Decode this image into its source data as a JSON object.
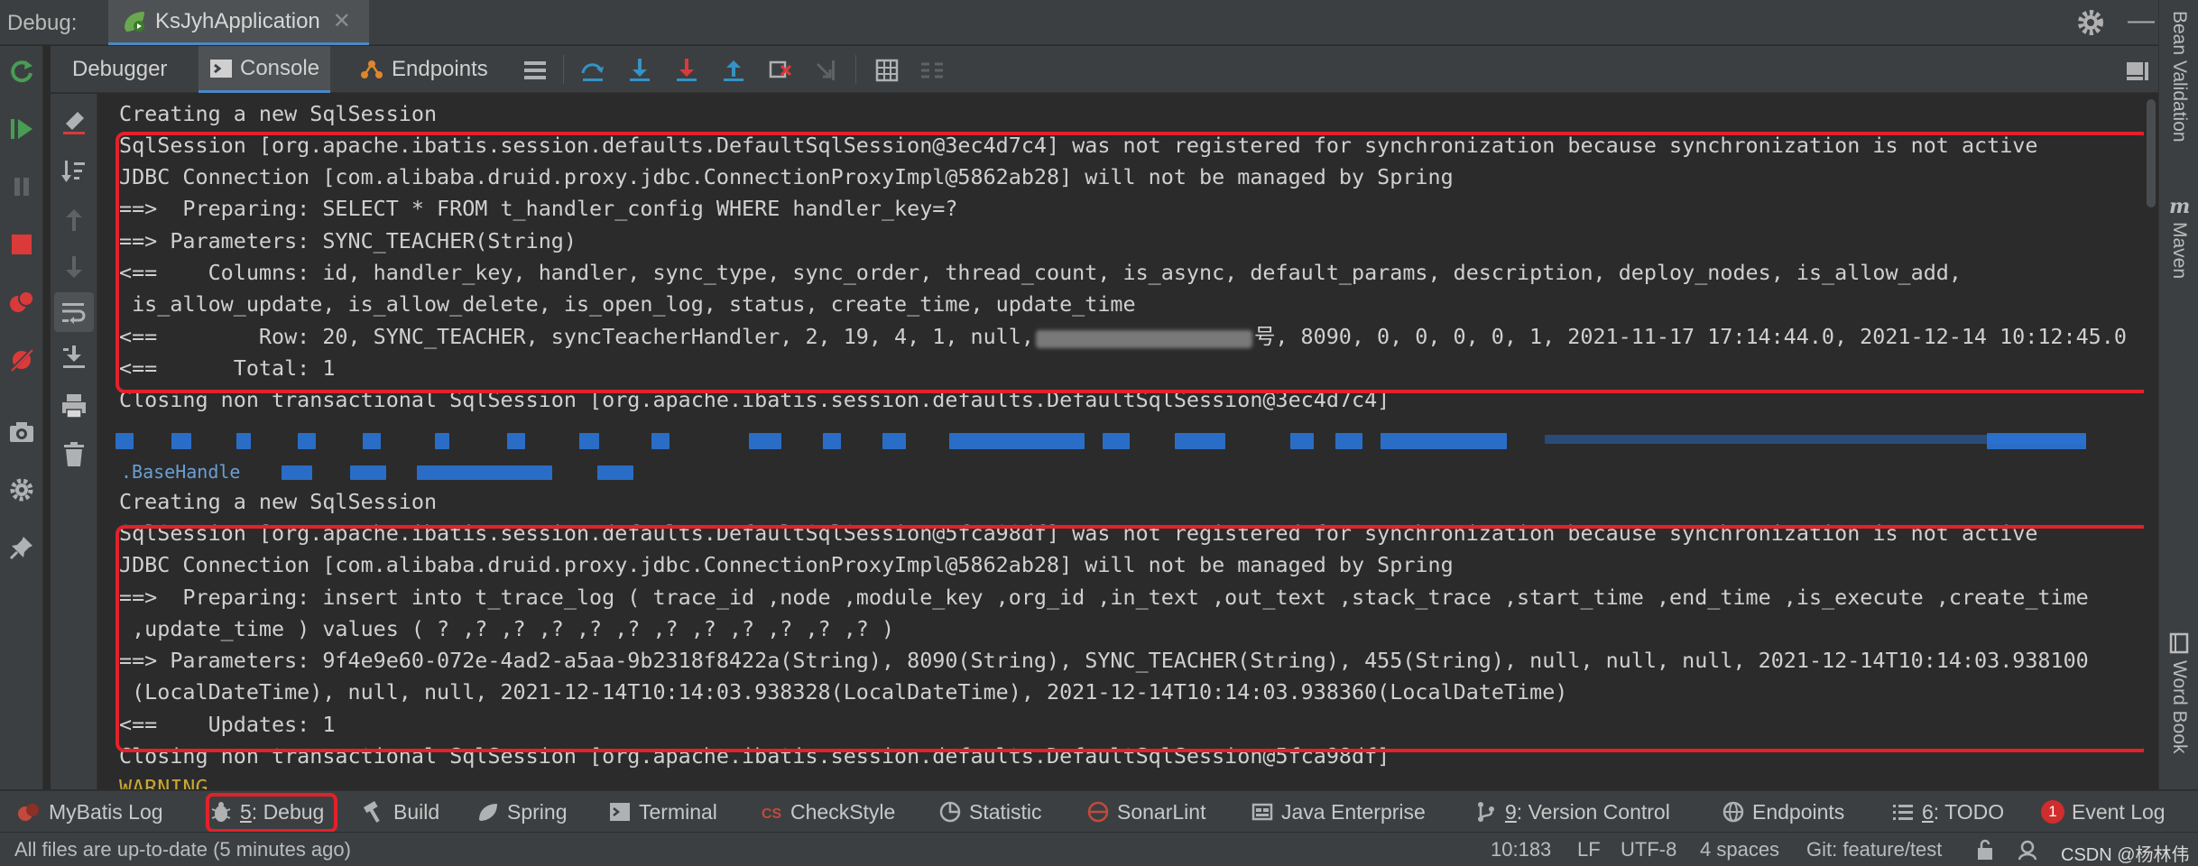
{
  "title_bar": {
    "debug_label": "Debug:",
    "run_config_tab": "KsJyhApplication",
    "close_glyph": "✕"
  },
  "toolbar": {
    "tabs": [
      {
        "label": "Debugger",
        "icon": "none"
      },
      {
        "label": "Console",
        "icon": "console-icon"
      },
      {
        "label": "Endpoints",
        "icon": "endpoints-icon"
      }
    ],
    "active_tab": "Console"
  },
  "right_strip": {
    "bean_validation": "Bean Validation",
    "maven": "Maven",
    "word_book": "Word Book"
  },
  "console": {
    "lines": [
      "Creating a new SqlSession",
      "SqlSession [org.apache.ibatis.session.defaults.DefaultSqlSession@3ec4d7c4] was not registered for synchronization because synchronization is not active",
      "JDBC Connection [com.alibaba.druid.proxy.jdbc.ConnectionProxyImpl@5862ab28] will not be managed by Spring",
      "==>  Preparing: SELECT * FROM t_handler_config WHERE handler_key=?",
      "==> Parameters: SYNC_TEACHER(String)",
      "<==    Columns: id, handler_key, handler, sync_type, sync_order, thread_count, is_async, default_params, description, deploy_nodes, is_allow_add,",
      " is_allow_update, is_allow_delete, is_open_log, status, create_time, update_time",
      "<==        Row: 20, SYNC_TEACHER, syncTeacherHandler, 2, 19, 4, 1, null,",
      "号, 8090, 0, 0, 0, 0, 1, 2021-11-17 17:14:44.0, 2021-12-14 10:12:45.0",
      "<==      Total: 1",
      "Closing non transactional SqlSession [org.apache.ibatis.session.defaults.DefaultSqlSession@3ec4d7c4]",
      "Creating a new SqlSession",
      "SqlSession [org.apache.ibatis.session.defaults.DefaultSqlSession@5fca98df] was not registered for synchronization because synchronization is not active",
      "JDBC Connection [com.alibaba.druid.proxy.jdbc.ConnectionProxyImpl@5862ab28] will not be managed by Spring",
      "==>  Preparing: insert into t_trace_log ( trace_id ,node ,module_key ,org_id ,in_text ,out_text ,stack_trace ,start_time ,end_time ,is_execute ,create_time",
      " ,update_time ) values ( ? ,? ,? ,? ,? ,? ,? ,? ,? ,? ,? ,? )",
      "==> Parameters: 9f4e9e60-072e-4ad2-a5aa-9b2318f8422a(String), 8090(String), SYNC_TEACHER(String), 455(String), null, null, null, 2021-12-14T10:14:03.938100",
      " (LocalDateTime), null, null, 2021-12-14T10:14:03.938328(LocalDateTime), 2021-12-14T10:14:03.938360(LocalDateTime)",
      "<==    Updates: 1",
      "Closing non transactional SqlSession [org.apache.ibatis.session.defaults.DefaultSqlSession@5fca98df]"
    ],
    "partial_line_1": ".BaseHandle",
    "partial_line_2": "WARNING"
  },
  "tool_windows": [
    {
      "label": "MyBatis Log",
      "icon": "mybatis-icon"
    },
    {
      "prefix": "5",
      "label": ": Debug",
      "icon": "bug-icon"
    },
    {
      "label": "Build",
      "icon": "hammer-icon"
    },
    {
      "label": "Spring",
      "icon": "spring-leaf-icon"
    },
    {
      "label": "Terminal",
      "icon": "terminal-icon"
    },
    {
      "label": "CheckStyle",
      "icon": "checkstyle-icon"
    },
    {
      "label": "Statistic",
      "icon": "pie-icon"
    },
    {
      "label": "SonarLint",
      "icon": "sonarlint-icon"
    },
    {
      "label": "Java Enterprise",
      "icon": "java-ee-icon"
    },
    {
      "prefix": "9",
      "label": ": Version Control",
      "icon": "vcs-icon"
    },
    {
      "label": "Endpoints",
      "icon": "globe-icon"
    },
    {
      "prefix": "6",
      "label": ": TODO",
      "icon": "list-icon"
    },
    {
      "label": "Event Log",
      "icon": "event-log-icon",
      "badge": "1"
    }
  ],
  "status_bar": {
    "message": "All files are up-to-date (5 minutes ago)",
    "position": "10:183",
    "line_sep": "LF",
    "encoding": "UTF-8",
    "indent": "4 spaces",
    "git_branch": "Git: feature/test",
    "watermark": "CSDN @杨林伟"
  },
  "colors": {
    "highlight_red": "#e3212a",
    "accent_blue": "#4a88c7",
    "console_bg": "#2b2b2b",
    "panel_bg": "#3c3f41"
  }
}
